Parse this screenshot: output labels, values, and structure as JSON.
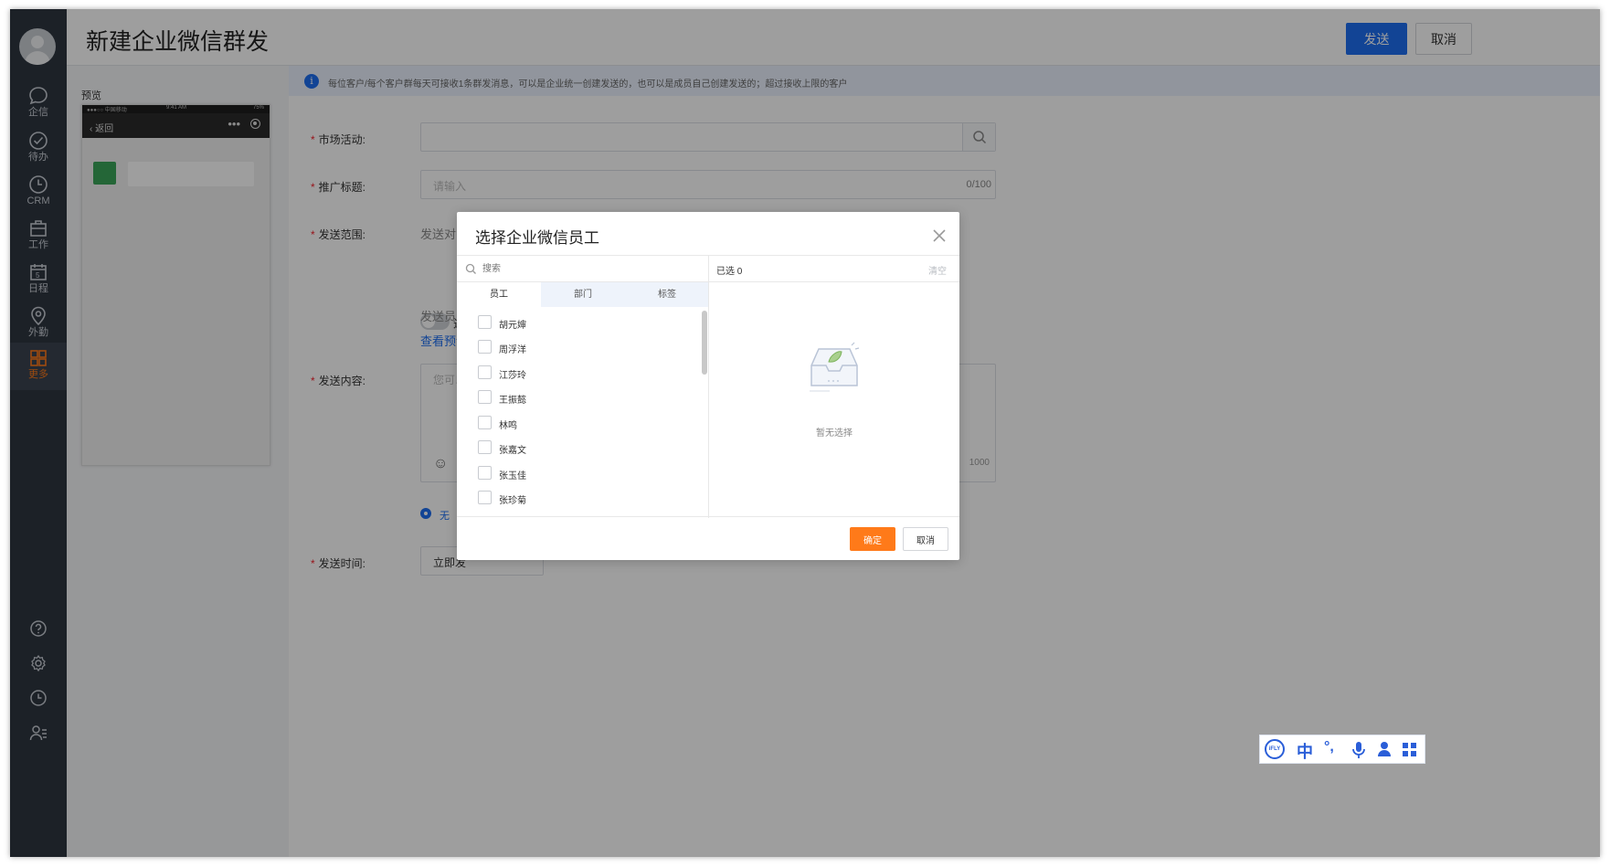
{
  "page": {
    "title": "新建企业微信群发",
    "send_button": "发送",
    "cancel_button": "取消"
  },
  "sidebar": {
    "items": [
      {
        "label": "企信",
        "icon": "chat-icon"
      },
      {
        "label": "待办",
        "icon": "check-circle-icon"
      },
      {
        "label": "CRM",
        "icon": "clock-icon"
      },
      {
        "label": "工作",
        "icon": "briefcase-icon"
      },
      {
        "label": "日程",
        "icon": "calendar-icon"
      },
      {
        "label": "外勤",
        "icon": "location-pin-icon"
      },
      {
        "label": "更多",
        "icon": "grid-icon"
      }
    ],
    "calendar_day": "5",
    "active_item": "更多",
    "bottom_icons": [
      "help-icon",
      "settings-gear-icon",
      "history-clock-icon",
      "user-list-icon"
    ],
    "active_color": "#ff7a19"
  },
  "preview": {
    "label": "预览",
    "status_carrier": "●●●○○ 中国移动",
    "status_time": "9:41 AM",
    "status_battery": "75%",
    "back_label": "返回",
    "more_label": "•••"
  },
  "notice": {
    "text": "每位客户/每个客户群每天可接收1条群发消息，可以是企业统一创建发送的，也可以是成员自己创建发送的；超过接收上限的客户"
  },
  "form": {
    "market_label": "市场活动:",
    "title_label": "推广标题:",
    "title_placeholder": "请输入",
    "title_counter": "0/100",
    "scope_label": "发送范围:",
    "scope_partial": "发送对象",
    "filter_partial": "过滤",
    "sender_partial": "发送员工",
    "preview_link_partial": "查看预计",
    "content_label": "发送内容:",
    "content_placeholder_partial": "您可以",
    "content_counter_partial": "1000",
    "radio_option": "无",
    "time_label": "发送时间:",
    "time_value_partial": "立即发"
  },
  "dialog": {
    "title": "选择企业微信员工",
    "search_placeholder": "搜索",
    "tabs": [
      "员工",
      "部门",
      "标签"
    ],
    "employees": [
      "胡元婶",
      "周浮洋",
      "江莎玲",
      "王振懿",
      "林鸣",
      "张嘉文",
      "张玉佳",
      "张珍菊"
    ],
    "selected_label": "已选 0",
    "clear_label": "清空",
    "empty_text": "暂无选择",
    "confirm_button": "确定",
    "cancel_button": "取消"
  },
  "ime": {
    "items": [
      "iFLY",
      "中",
      "°,",
      "mic-icon",
      "user-icon",
      "apps-icon"
    ]
  },
  "colors": {
    "primary_blue": "#1d6ef1",
    "accent_orange": "#ff7a19",
    "sidebar_bg": "#2e3640"
  }
}
